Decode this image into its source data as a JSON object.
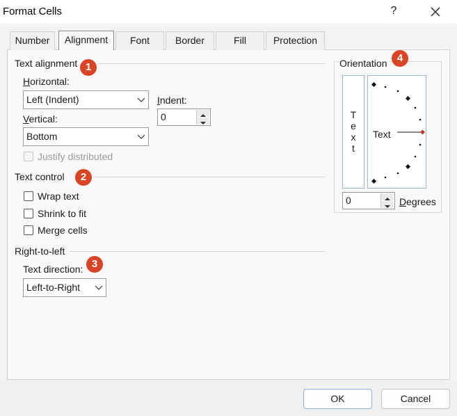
{
  "window": {
    "title": "Format Cells",
    "help": "?"
  },
  "tabs": [
    {
      "label": "Number"
    },
    {
      "label": "Alignment"
    },
    {
      "label": "Font"
    },
    {
      "label": "Border"
    },
    {
      "label": "Fill"
    },
    {
      "label": "Protection"
    }
  ],
  "text_alignment": {
    "heading": "Text alignment",
    "badge": "1",
    "horizontal_label": "Horizontal:",
    "horizontal_value": "Left (Indent)",
    "vertical_label": "Vertical:",
    "vertical_value": "Bottom",
    "indent_label": "Indent:",
    "indent_value": "0",
    "justify_label": "Justify distributed"
  },
  "text_control": {
    "heading": "Text control",
    "badge": "2",
    "wrap_label": "Wrap text",
    "shrink_label": "Shrink to fit",
    "merge_label": "Merge cells"
  },
  "rtl": {
    "heading": "Right-to-left",
    "badge": "3",
    "direction_label": "Text direction:",
    "direction_value": "Left-to-Right"
  },
  "orientation": {
    "heading": "Orientation",
    "badge": "4",
    "vertical_text": [
      "T",
      "e",
      "x",
      "t"
    ],
    "dial_text": "Text",
    "degrees_value": "0",
    "degrees_label": "Degrees"
  },
  "footer": {
    "ok": "OK",
    "cancel": "Cancel"
  },
  "colors": {
    "badge": "#d94424",
    "dial_marker": "#c0392b",
    "dialog_bg": "#f3f3f3"
  }
}
